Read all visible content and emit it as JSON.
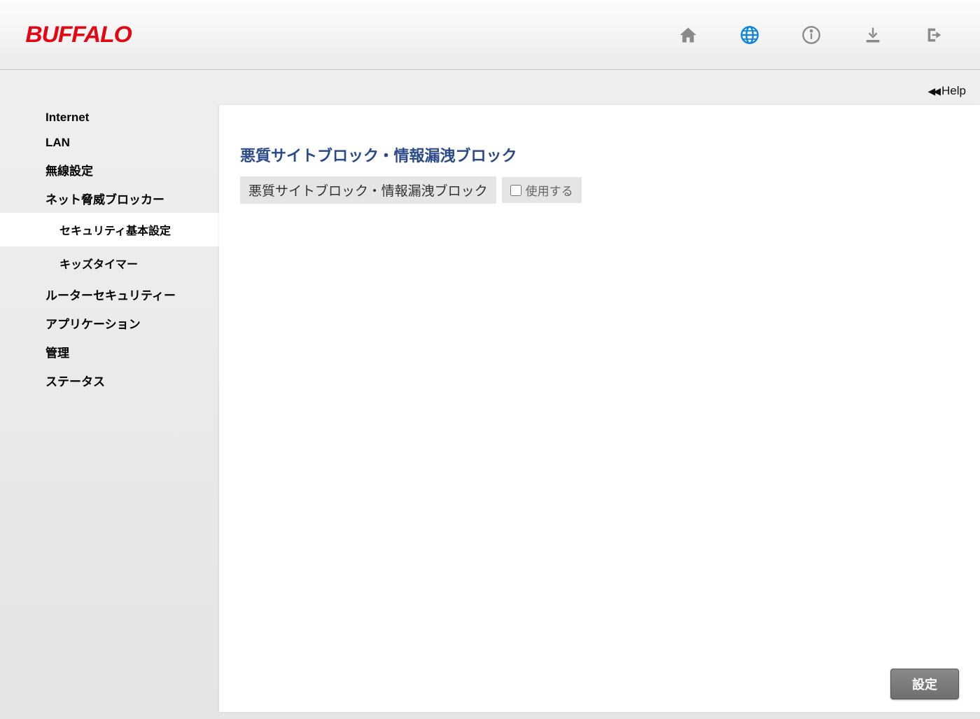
{
  "logo": "BUFFALO",
  "help_label": "Help",
  "sidebar": {
    "items": [
      {
        "label": "Internet"
      },
      {
        "label": "LAN"
      },
      {
        "label": "無線設定"
      },
      {
        "label": "ネット脅威ブロッカー"
      },
      {
        "label": "ルーターセキュリティー"
      },
      {
        "label": "アプリケーション"
      },
      {
        "label": "管理"
      },
      {
        "label": "ステータス"
      }
    ],
    "subitems": [
      {
        "label": "セキュリティ基本設定",
        "active": true
      },
      {
        "label": "キッズタイマー",
        "active": false
      }
    ]
  },
  "main": {
    "section_title": "悪質サイトブロック・情報漏洩ブロック",
    "setting_label": "悪質サイトブロック・情報漏洩ブロック",
    "checkbox_label": "使用する",
    "checkbox_checked": false,
    "button_label": "設定"
  }
}
